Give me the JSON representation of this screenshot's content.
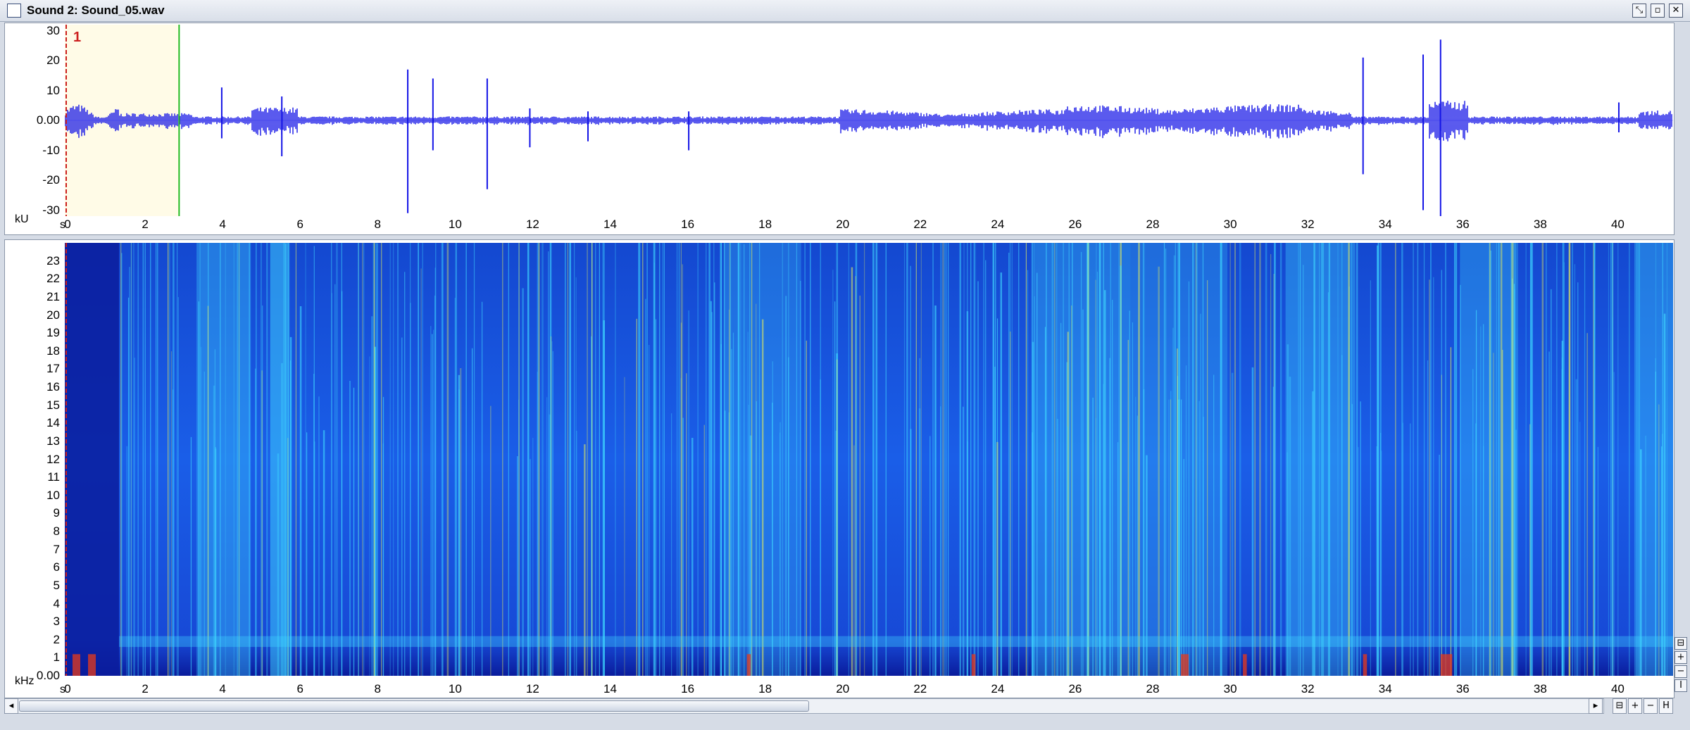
{
  "window": {
    "title": "Sound 2: Sound_05.wav",
    "buttons": [
      "⤡",
      "▫",
      "✕"
    ]
  },
  "waveform": {
    "unit": "kU",
    "y_ticks": [
      "30",
      "20",
      "10",
      "0.00",
      "-10",
      "-20",
      "-30"
    ],
    "y_values": [
      30,
      20,
      10,
      0,
      -10,
      -20,
      -30
    ],
    "y_range": [
      -32,
      32
    ],
    "marker_label": "1",
    "marker_time": 0.0,
    "cursor_time": 2.95,
    "colors": {
      "wave": "#1414e6",
      "marker": "#cc1f1f",
      "cursor": "#22bb22",
      "selection": "#fff7d0"
    }
  },
  "spectrogram": {
    "unit": "kHz",
    "y_ticks": [
      "23",
      "22",
      "21",
      "20",
      "19",
      "18",
      "17",
      "16",
      "15",
      "14",
      "13",
      "12",
      "11",
      "10",
      "9",
      "8",
      "7",
      "6",
      "5",
      "4",
      "3",
      "2",
      "1",
      "0.00"
    ],
    "y_values": [
      23,
      22,
      21,
      20,
      19,
      18,
      17,
      16,
      15,
      14,
      13,
      12,
      11,
      10,
      9,
      8,
      7,
      6,
      5,
      4,
      3,
      2,
      1,
      0
    ],
    "y_range": [
      0,
      24
    ],
    "colors": {
      "low": "#0a1c9c",
      "mid": "#1a6cf0",
      "high": "#3fd8ff",
      "peak": "#e8f05a",
      "hot": "#e83a1a"
    }
  },
  "time_axis": {
    "unit": "s",
    "ticks": [
      "0",
      "2",
      "4",
      "6",
      "8",
      "10",
      "12",
      "14",
      "16",
      "18",
      "20",
      "22",
      "24",
      "26",
      "28",
      "30",
      "32",
      "34",
      "36",
      "38",
      "40"
    ],
    "values": [
      0,
      2,
      4,
      6,
      8,
      10,
      12,
      14,
      16,
      18,
      20,
      22,
      24,
      26,
      28,
      30,
      32,
      34,
      36,
      38,
      40
    ],
    "range": [
      0,
      41.5
    ]
  },
  "bottom_bar": {
    "scroll_left": "◂",
    "scroll_right": "▸",
    "zoom_buttons": [
      "⊟",
      "+",
      "−",
      "H"
    ]
  },
  "side_buttons": [
    "⊟",
    "+",
    "−",
    "Ⅰ"
  ]
}
